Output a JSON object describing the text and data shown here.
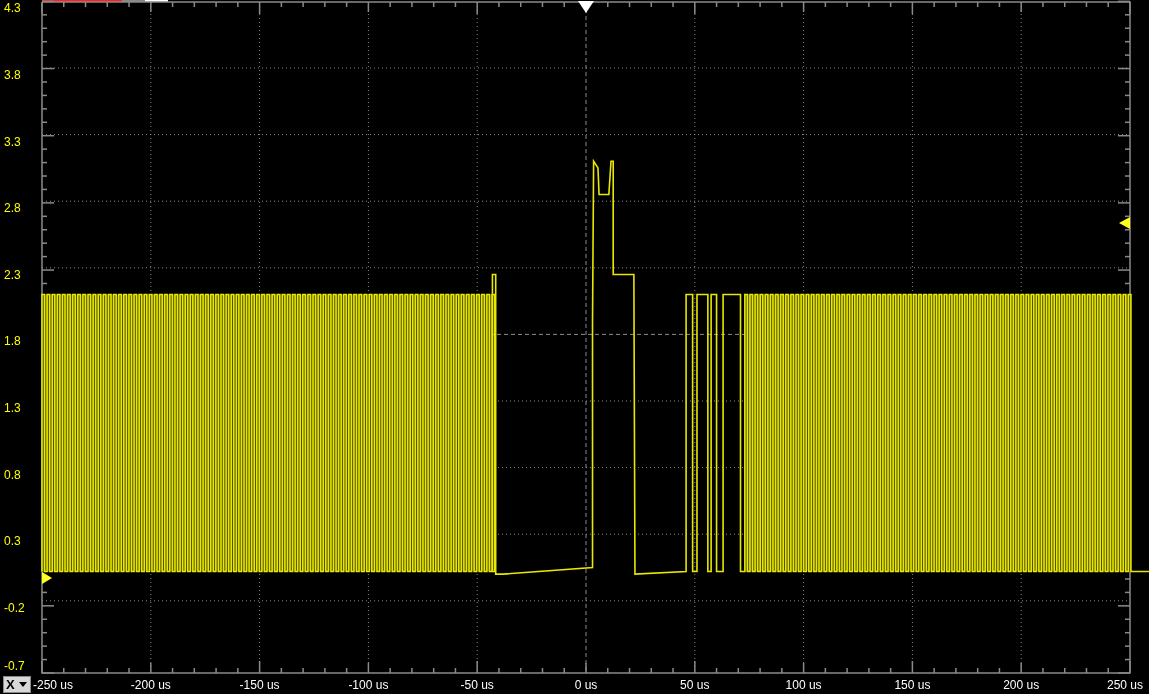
{
  "y_axis": {
    "labels": [
      "4.3",
      "3.8",
      "3.3",
      "2.8",
      "2.3",
      "1.8",
      "1.3",
      "0.8",
      "0.3",
      "-0.2",
      "-0.7"
    ]
  },
  "x_axis": {
    "labels": [
      "-250 us",
      "-200 us",
      "-150 us",
      "-100 us",
      "-50 us",
      "0 us",
      "50 us",
      "100 us",
      "150 us",
      "200 us",
      "250 us"
    ]
  },
  "axis_selector": {
    "value": "X"
  }
}
